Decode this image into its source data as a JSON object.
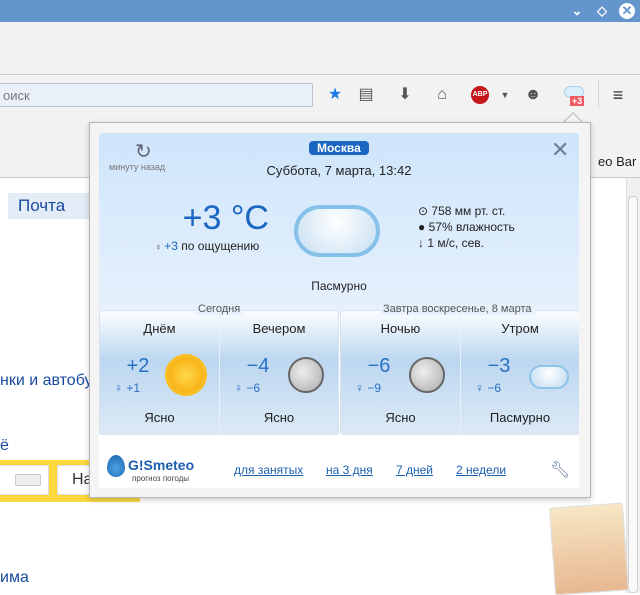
{
  "window": {
    "controls": [
      "minimize",
      "maximize",
      "close"
    ]
  },
  "toolbar": {
    "search_placeholder": "оиск",
    "icons": [
      "star-icon",
      "reading-list-icon",
      "download-icon",
      "home-icon",
      "adblock-icon",
      "chevron-down-icon",
      "smiley-icon",
      "weather-icon",
      "menu-icon"
    ],
    "adblock_label": "ABP",
    "weather_badge": "+3",
    "bookmark_bar_text": "eo Bar"
  },
  "page": {
    "mail_link": "Почта",
    "link_1": "нки и автобу",
    "link_2": "ё",
    "search_button": "На",
    "link_3": "има"
  },
  "weather": {
    "updated": "минуту назад",
    "city": "Москва",
    "datetime": "Суббота, 7 марта, 13:42",
    "temp": "+3 °C",
    "feels_value": "+3",
    "feels_label": "по ощущению",
    "pressure": "758 мм рт. ст.",
    "humidity": "57% влажность",
    "wind": "1 м/с, сев.",
    "condition": "Пасмурно",
    "today_label": "Сегодня",
    "tomorrow_label": "Завтра воскресенье, 8 марта",
    "periods": [
      {
        "name": "Днём",
        "temp": "+2",
        "feels": "+1",
        "cond": "Ясно",
        "icon": "sun"
      },
      {
        "name": "Вечером",
        "temp": "−4",
        "feels": "−6",
        "cond": "Ясно",
        "icon": "moon"
      },
      {
        "name": "Ночью",
        "temp": "−6",
        "feels": "−9",
        "cond": "Ясно",
        "icon": "moon"
      },
      {
        "name": "Утром",
        "temp": "−3",
        "feels": "−6",
        "cond": "Пасмурно",
        "icon": "cloud"
      }
    ],
    "brand": "G!Smeteo",
    "brand_sub": "прогноз погоды",
    "links": [
      "для занятых",
      "на 3 дня",
      "7 дней",
      "2 недели"
    ],
    "accent": "#1a66c2"
  }
}
